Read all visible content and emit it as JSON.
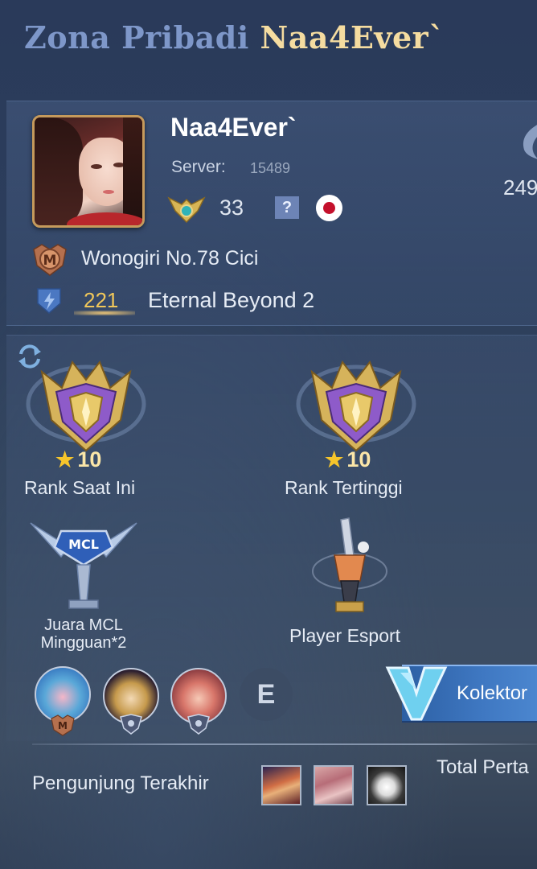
{
  "header": {
    "title_prefix": "Zona Pribadi",
    "title_name": "Naa4Ever`"
  },
  "profile": {
    "username": "Naa4Ever`",
    "server_label": "Server:",
    "server_value": "15489",
    "level": "33",
    "help_glyph": "?",
    "side_value": "249",
    "squad_name": "Wonogiri No.78 Cici",
    "credit_value": "221",
    "credit_title": "Eternal Beyond 2",
    "icons": [
      "avatar-portrait",
      "level-badge-icon",
      "help-icon",
      "japan-flag-icon",
      "side-stat-icon",
      "squad-m-icon",
      "credit-shield-icon"
    ]
  },
  "ranks": {
    "current": {
      "stars": "10",
      "label": "Rank Saat Ini"
    },
    "highest": {
      "stars": "10",
      "label": "Rank Tertinggi"
    },
    "star_glyph": "★"
  },
  "achievements": {
    "mcl_label": "Juara MCL Mingguan*2",
    "esport_label": "Player Esport"
  },
  "heroes": {
    "e_glyph": "E",
    "collector_label": "Kolektor"
  },
  "visitors": {
    "label": "Pengunjung Terakhir",
    "total_label": "Total Perta"
  },
  "colors": {
    "title_prefix": "#7e97c9",
    "title_name": "#f5dca0",
    "credit_value": "#f0c75a",
    "collector_banner": "#3f78c2"
  }
}
